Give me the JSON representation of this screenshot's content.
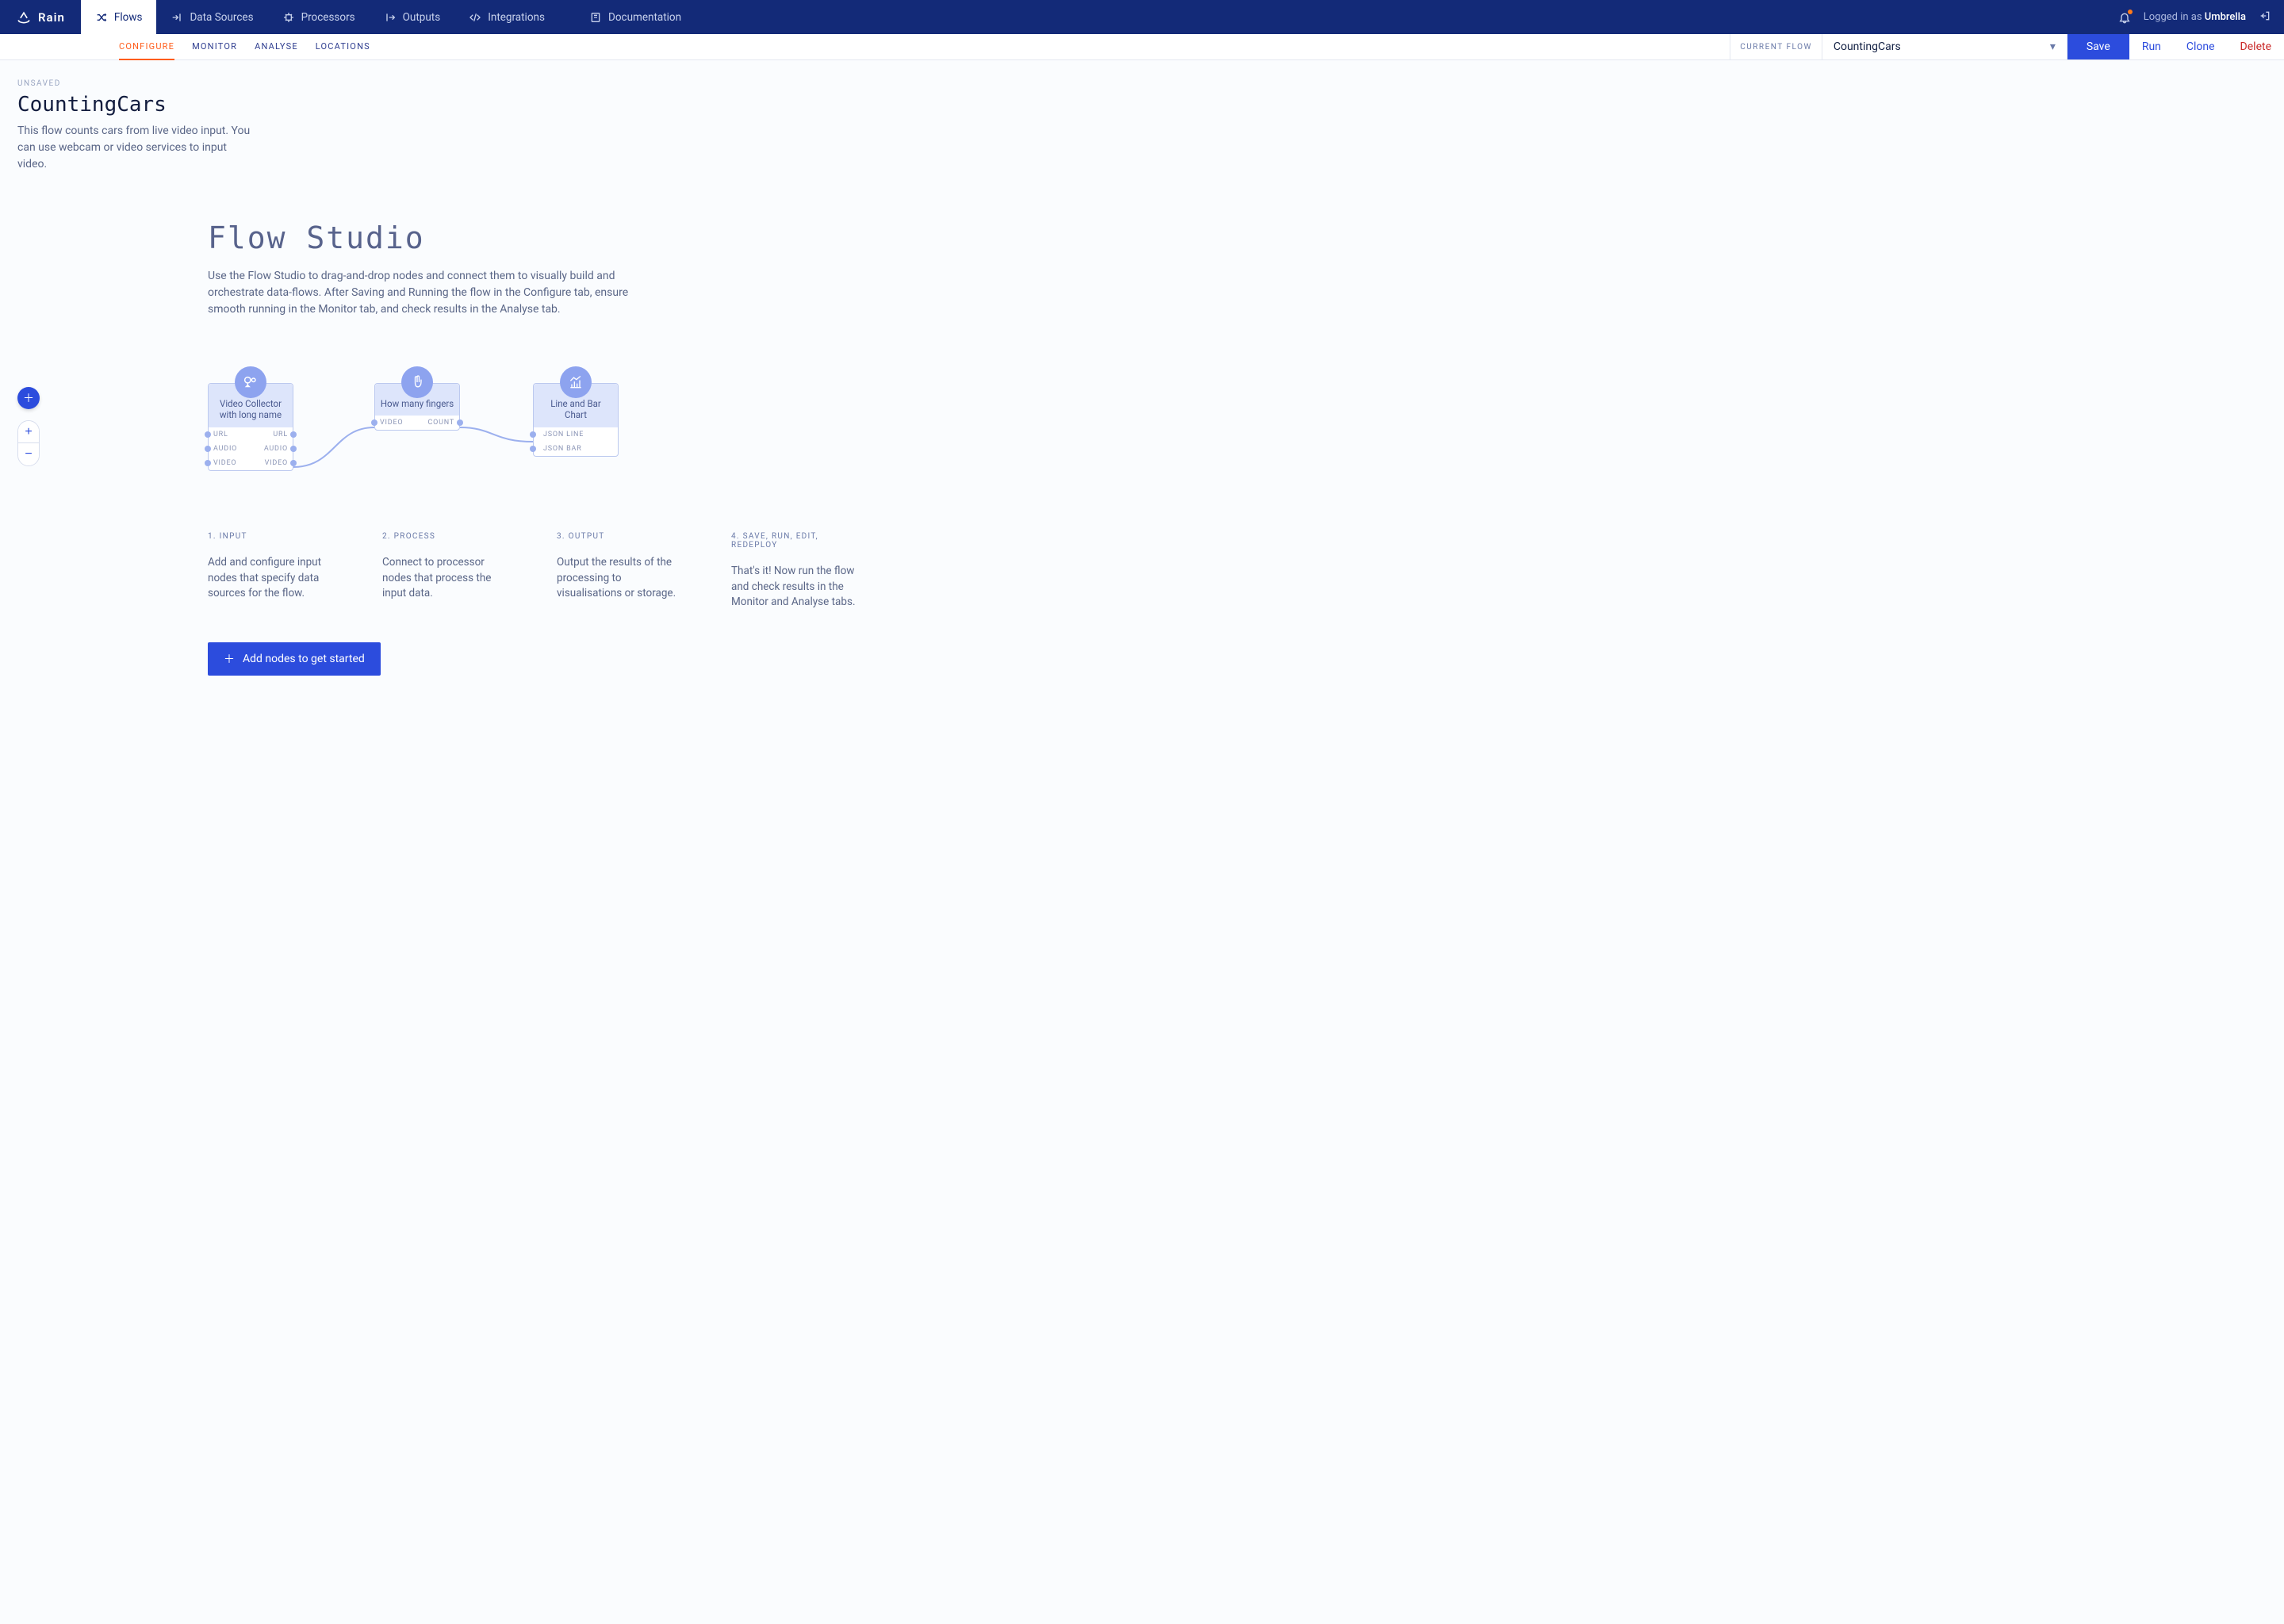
{
  "brand": {
    "name": "Rain"
  },
  "nav": {
    "tabs": [
      {
        "label": "Flows"
      },
      {
        "label": "Data Sources"
      },
      {
        "label": "Processors"
      },
      {
        "label": "Outputs"
      },
      {
        "label": "Integrations"
      },
      {
        "label": "Documentation"
      }
    ],
    "login_prefix": "Logged in as ",
    "username": "Umbrella"
  },
  "subnav": {
    "tabs": [
      {
        "label": "CONFIGURE"
      },
      {
        "label": "MONITOR"
      },
      {
        "label": "ANALYSE"
      },
      {
        "label": "LOCATIONS"
      }
    ],
    "current_flow_label": "CURRENT FLOW",
    "current_flow_value": "CountingCars",
    "save": "Save",
    "run": "Run",
    "clone": "Clone",
    "delete": "Delete"
  },
  "page": {
    "unsaved": "UNSAVED",
    "title": "CountingCars",
    "description": "This flow counts cars from live video input. You can use webcam or video services to input video."
  },
  "studio": {
    "title": "Flow Studio",
    "description": "Use the Flow Studio to drag-and-drop nodes and connect them to visually build and orchestrate data-flows. After Saving and Running the flow in the Configure tab, ensure smooth running in the Monitor tab, and check results in the Analyse tab."
  },
  "nodes": {
    "n1": {
      "title": "Video Collector with long name",
      "ports": [
        {
          "left": "URL",
          "right": "URL"
        },
        {
          "left": "AUDIO",
          "right": "AUDIO"
        },
        {
          "left": "VIDEO",
          "right": "VIDEO"
        }
      ]
    },
    "n2": {
      "title": "How many fingers",
      "ports": [
        {
          "left": "VIDEO",
          "right": "COUNT"
        }
      ]
    },
    "n3": {
      "title": "Line and Bar Chart",
      "ports": [
        {
          "left": "JSON LINE"
        },
        {
          "left": "JSON BAR"
        }
      ]
    }
  },
  "steps": [
    {
      "title": "1. INPUT",
      "desc": "Add and configure input nodes that specify data sources for the flow."
    },
    {
      "title": "2. PROCESS",
      "desc": "Connect to processor nodes that process the input data."
    },
    {
      "title": "3. OUTPUT",
      "desc": "Output the results of the processing to visualisations or storage."
    },
    {
      "title": "4. SAVE, RUN, EDIT, REDEPLOY",
      "desc": "That's it! Now run the flow and check results in the Monitor and Analyse tabs."
    }
  ],
  "cta": "Add nodes to get started"
}
